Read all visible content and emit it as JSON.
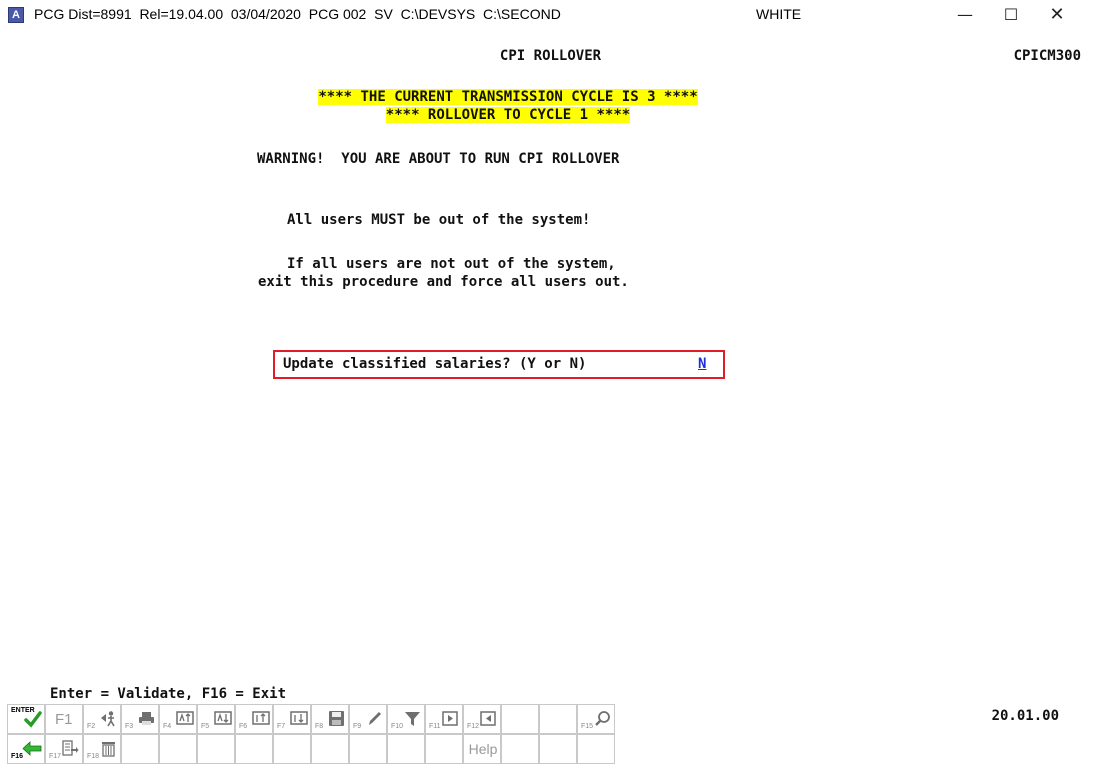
{
  "window": {
    "app_icon_letter": "A",
    "title": "PCG Dist=8991  Rel=19.04.00  03/04/2020  PCG 002  SV  C:\\DEVSYS  C:\\SECOND",
    "user": "WHITE",
    "minimize": "—",
    "maximize": "☐",
    "close": "✕"
  },
  "screen": {
    "title": "CPI ROLLOVER",
    "program_id": "CPICM300",
    "banner_line1": "**** THE CURRENT TRANSMISSION CYCLE IS 3 ****",
    "banner_line2": "**** ROLLOVER TO CYCLE 1 ****",
    "warning": "WARNING!  YOU ARE ABOUT TO RUN CPI ROLLOVER",
    "users_message": "All users MUST be out of the system!",
    "exit_message_line1": "If all users are not out of the system,",
    "exit_message_line2": "exit this procedure and force all users out.",
    "prompt_label": "Update classified salaries? (Y or N)",
    "prompt_value": "N",
    "key_help": "Enter = Validate, F16 = Exit",
    "date_code": "20.01.00"
  },
  "fkeys": {
    "row1": [
      {
        "key": "ENTER",
        "name": "enter-key",
        "icon": "check-icon"
      },
      {
        "key": "F1",
        "name": "f1-key",
        "icon": ""
      },
      {
        "key": "F2",
        "name": "f2-key",
        "icon": "person-arrow-icon"
      },
      {
        "key": "F3",
        "name": "f3-key",
        "icon": "printer-icon"
      },
      {
        "key": "F4",
        "name": "f4-key",
        "icon": "page-up-icon"
      },
      {
        "key": "F5",
        "name": "f5-key",
        "icon": "page-down-icon"
      },
      {
        "key": "F6",
        "name": "f6-key",
        "icon": "first-record-icon"
      },
      {
        "key": "F7",
        "name": "f7-key",
        "icon": "last-record-icon"
      },
      {
        "key": "F8",
        "name": "f8-key",
        "icon": "save-icon"
      },
      {
        "key": "F9",
        "name": "f9-key",
        "icon": "pencil-icon"
      },
      {
        "key": "F10",
        "name": "f10-key",
        "icon": "filter-icon"
      },
      {
        "key": "F11",
        "name": "f11-key",
        "icon": "next-icon"
      },
      {
        "key": "F12",
        "name": "f12-key",
        "icon": "previous-icon"
      },
      {
        "key": "",
        "name": "f13-key",
        "icon": ""
      },
      {
        "key": "",
        "name": "f14-key",
        "icon": ""
      },
      {
        "key": "F15",
        "name": "f15-key",
        "icon": "search-icon"
      }
    ],
    "row2": [
      {
        "key": "F16",
        "name": "f16-key",
        "icon": "exit-arrow-icon"
      },
      {
        "key": "F17",
        "name": "f17-key",
        "icon": "export-icon"
      },
      {
        "key": "F18",
        "name": "f18-key",
        "icon": "trash-icon"
      },
      {
        "key": "",
        "name": "blank-key",
        "icon": ""
      },
      {
        "key": "",
        "name": "blank-key",
        "icon": ""
      },
      {
        "key": "",
        "name": "blank-key",
        "icon": ""
      },
      {
        "key": "",
        "name": "blank-key",
        "icon": ""
      },
      {
        "key": "",
        "name": "blank-key",
        "icon": ""
      },
      {
        "key": "",
        "name": "blank-key",
        "icon": ""
      },
      {
        "key": "",
        "name": "blank-key",
        "icon": ""
      },
      {
        "key": "",
        "name": "blank-key",
        "icon": ""
      },
      {
        "key": "",
        "name": "blank-key",
        "icon": ""
      },
      {
        "key": "",
        "name": "blank-key",
        "icon": ""
      },
      {
        "key": "",
        "name": "blank-key",
        "icon": ""
      },
      {
        "key": "",
        "name": "blank-key",
        "icon": ""
      },
      {
        "key": "",
        "name": "blank-key",
        "icon": ""
      }
    ],
    "help_label": "Help",
    "colors": {
      "check": "#2a9b2a",
      "exit_arrow": "#35b635",
      "icon_gray": "#6f6f6f"
    }
  }
}
